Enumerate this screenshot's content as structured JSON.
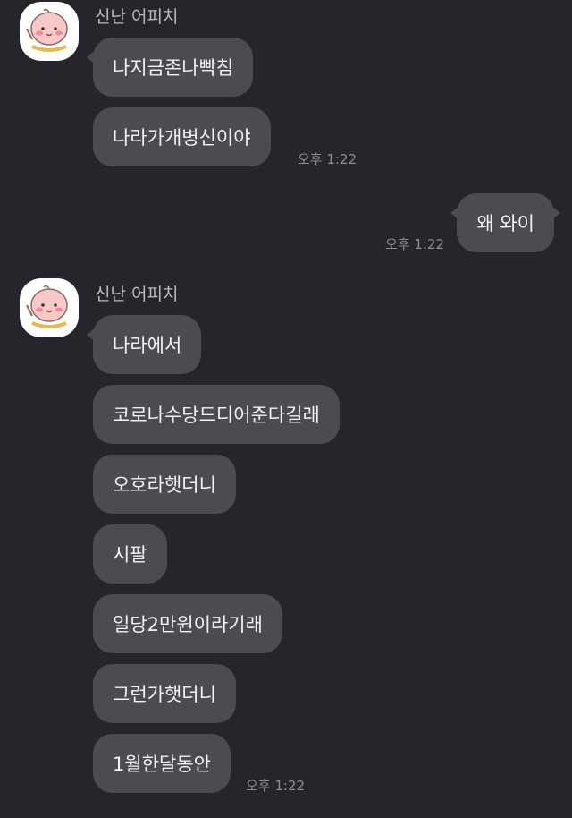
{
  "groups": [
    {
      "sender": "신난 어피치",
      "avatar_icon": "apeach-avatar-icon",
      "messages": [
        "나지금존나빡침",
        "나라가개병신이야"
      ],
      "time": "오후 1:22"
    },
    {
      "sender": "신난 어피치",
      "avatar_icon": "apeach-avatar-icon",
      "messages": [
        "나라에서",
        "코로나수당드디어준다길래",
        "오호라햇더니",
        "시팔",
        "일당2만원이라기래",
        "그런가햇더니",
        "1월한달동안"
      ],
      "time": "오후 1:22"
    }
  ],
  "outgoing": {
    "message": "왜 와이",
    "time": "오후 1:22"
  },
  "colors": {
    "background": "#25262b",
    "bubble": "#4b4c51",
    "text": "#f2f2f2",
    "meta": "#8d8e92"
  }
}
